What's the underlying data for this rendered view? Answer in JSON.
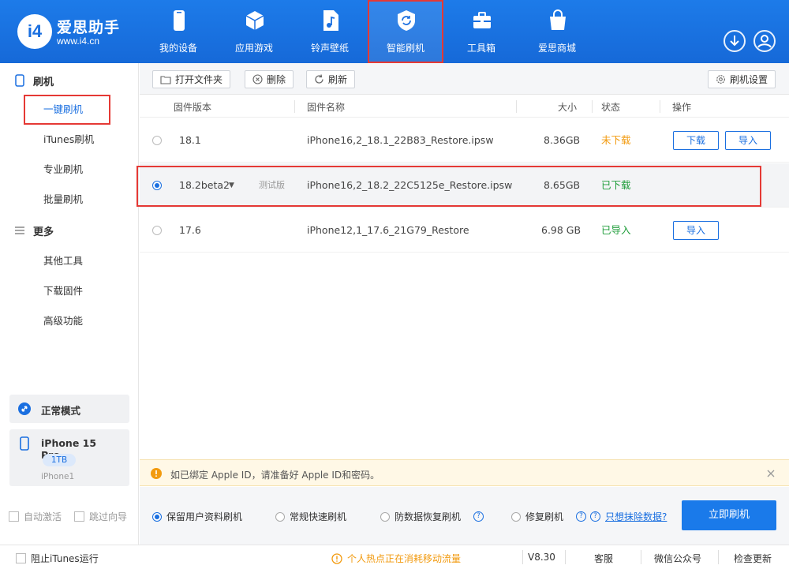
{
  "app": {
    "brand_name": "爱思助手",
    "brand_url": "www.i4.cn",
    "logo_text": "i4"
  },
  "nav": {
    "items": [
      {
        "label": "我的设备",
        "icon": "phone-icon"
      },
      {
        "label": "应用游戏",
        "icon": "cube-icon"
      },
      {
        "label": "铃声壁纸",
        "icon": "music-file-icon"
      },
      {
        "label": "智能刷机",
        "icon": "refresh-shield-icon",
        "active": true
      },
      {
        "label": "工具箱",
        "icon": "toolbox-icon"
      },
      {
        "label": "爱思商城",
        "icon": "shopping-bag-icon"
      }
    ]
  },
  "sidebar": {
    "flash_heading": "刷机",
    "flash_items": [
      "一键刷机",
      "iTunes刷机",
      "专业刷机",
      "批量刷机"
    ],
    "more_heading": "更多",
    "more_items": [
      "其他工具",
      "下载固件",
      "高级功能"
    ],
    "mode_label": "正常模式",
    "device_name": "iPhone 15 Pro...",
    "device_capacity": "1TB",
    "device_model": "iPhone1",
    "auto_activate": "自动激活",
    "skip_guide": "跳过向导"
  },
  "toolbar": {
    "open_folder": "打开文件夹",
    "delete": "删除",
    "refresh": "刷新",
    "settings": "刷机设置"
  },
  "table": {
    "headers": {
      "version": "固件版本",
      "name": "固件名称",
      "size": "大小",
      "status": "状态",
      "action": "操作"
    },
    "rows": [
      {
        "version": "18.1",
        "beta_tag": "",
        "name": "iPhone16,2_18.1_22B83_Restore.ipsw",
        "size": "8.36GB",
        "status": "未下载",
        "actions": [
          "下载",
          "导入"
        ]
      },
      {
        "version": "18.2beta2",
        "beta_tag": "测试版",
        "name": "iPhone16,2_18.2_22C5125e_Restore.ipsw",
        "size": "8.65GB",
        "status": "已下载",
        "actions": []
      },
      {
        "version": "17.6",
        "beta_tag": "",
        "name": "iPhone12,1_17.6_21G79_Restore",
        "size": "6.98 GB",
        "status": "已导入",
        "actions": [
          "导入"
        ]
      }
    ]
  },
  "notice": {
    "text": "如已绑定 Apple ID，请准备好 Apple ID和密码。"
  },
  "options": {
    "keep_data": "保留用户资料刷机",
    "quick": "常规快速刷机",
    "anti_recovery": "防数据恢复刷机",
    "repair": "修复刷机",
    "erase_link": "只想抹除数据?",
    "flash_now": "立即刷机"
  },
  "footer": {
    "block_itunes": "阻止iTunes运行",
    "hotspot_warning": "个人热点正在消耗移动流量",
    "version": "V8.30",
    "support": "客服",
    "wechat": "微信公众号",
    "check_update": "检查更新"
  },
  "colors": {
    "brand_blue": "#1a6fe0",
    "highlight_red": "#e53935",
    "status_orange": "#f29a0e",
    "status_green": "#1f9d3a"
  }
}
